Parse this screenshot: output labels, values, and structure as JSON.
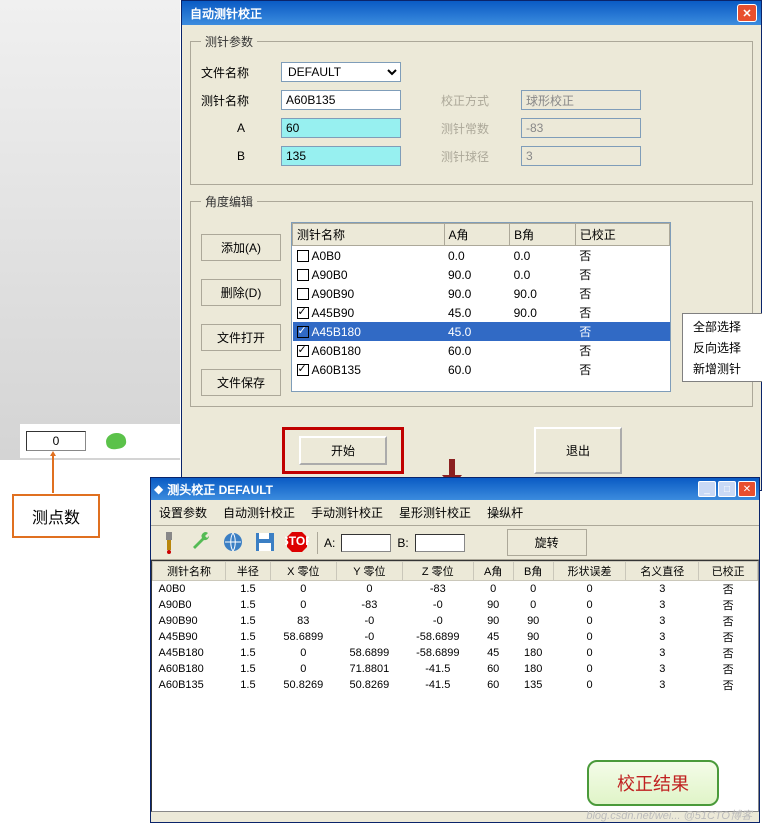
{
  "win1": {
    "title": "自动测针校正",
    "group_params": "测针参数",
    "filename_label": "文件名称",
    "filename_value": "DEFAULT",
    "probename_label": "测针名称",
    "probename_value": "A60B135",
    "a_label": "A",
    "a_value": "60",
    "b_label": "B",
    "b_value": "135",
    "corr_label": "校正方式",
    "corr_value": "球形校正",
    "const_label": "测针常数",
    "const_value": "-83",
    "diam_label": "测针球径",
    "diam_value": "3",
    "group_angles": "角度编辑",
    "btn_add": "添加(A)",
    "btn_del": "删除(D)",
    "btn_open": "文件打开",
    "btn_save": "文件保存",
    "th_name": "测针名称",
    "th_a": "A角",
    "th_b": "B角",
    "th_cal": "已校正",
    "angle_rows": [
      {
        "checked": false,
        "name": "A0B0",
        "a": "0.0",
        "b": "0.0",
        "cal": "否",
        "selected": false
      },
      {
        "checked": false,
        "name": "A90B0",
        "a": "90.0",
        "b": "0.0",
        "cal": "否",
        "selected": false
      },
      {
        "checked": false,
        "name": "A90B90",
        "a": "90.0",
        "b": "90.0",
        "cal": "否",
        "selected": false
      },
      {
        "checked": true,
        "name": "A45B90",
        "a": "45.0",
        "b": "90.0",
        "cal": "否",
        "selected": false
      },
      {
        "checked": true,
        "name": "A45B180",
        "a": "45.0",
        "b": "",
        "cal": "否",
        "selected": true
      },
      {
        "checked": true,
        "name": "A60B180",
        "a": "60.0",
        "b": "",
        "cal": "否",
        "selected": false
      },
      {
        "checked": true,
        "name": "A60B135",
        "a": "60.0",
        "b": "",
        "cal": "否",
        "selected": false
      }
    ],
    "ctx_all": "全部选择",
    "ctx_inv": "反向选择",
    "ctx_new": "新增测针",
    "btn_start": "开始",
    "btn_exit": "退出"
  },
  "count": {
    "value": "0",
    "label": "测点数"
  },
  "win2": {
    "title": "测头校正  DEFAULT",
    "menu": [
      "设置参数",
      "自动测针校正",
      "手动测针校正",
      "星形测针校正",
      "操纵杆"
    ],
    "a_label": "A:",
    "b_label": "B:",
    "a_val": "",
    "b_val": "",
    "rotate": "旋转",
    "headers": [
      "测针名称",
      "半径",
      "X 零位",
      "Y 零位",
      "Z 零位",
      "A角",
      "B角",
      "形状误差",
      "名义直径",
      "已校正"
    ],
    "rows": [
      [
        "A0B0",
        "1.5",
        "0",
        "0",
        "-83",
        "0",
        "0",
        "0",
        "3",
        "否"
      ],
      [
        "A90B0",
        "1.5",
        "0",
        "-83",
        "-0",
        "90",
        "0",
        "0",
        "3",
        "否"
      ],
      [
        "A90B90",
        "1.5",
        "83",
        "-0",
        "-0",
        "90",
        "90",
        "0",
        "3",
        "否"
      ],
      [
        "A45B90",
        "1.5",
        "58.6899",
        "-0",
        "-58.6899",
        "45",
        "90",
        "0",
        "3",
        "否"
      ],
      [
        "A45B180",
        "1.5",
        "0",
        "58.6899",
        "-58.6899",
        "45",
        "180",
        "0",
        "3",
        "否"
      ],
      [
        "A60B180",
        "1.5",
        "0",
        "71.8801",
        "-41.5",
        "60",
        "180",
        "0",
        "3",
        "否"
      ],
      [
        "A60B135",
        "1.5",
        "50.8269",
        "50.8269",
        "-41.5",
        "60",
        "135",
        "0",
        "3",
        "否"
      ]
    ]
  },
  "result_label": "校正结果",
  "watermark": "blog.csdn.net/wei... @51CTO博客"
}
